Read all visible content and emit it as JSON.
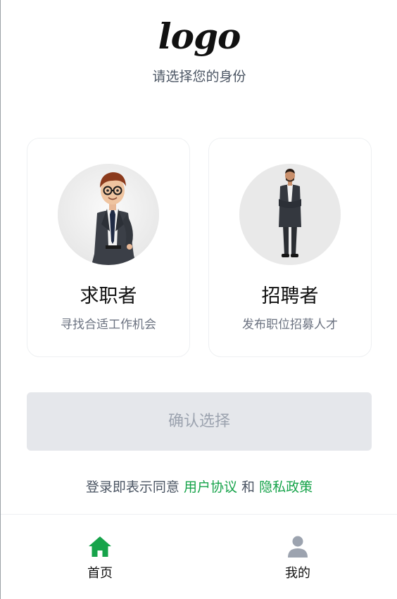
{
  "header": {
    "logo_text": "logo",
    "subtitle": "请选择您的身份"
  },
  "roles": [
    {
      "title": "求职者",
      "description": "寻找合适工作机会",
      "avatar": "cartoon-businessman-avatar"
    },
    {
      "title": "招聘者",
      "description": "发布职位招募人才",
      "avatar": "businessman-photo-avatar"
    }
  ],
  "confirm": {
    "label": "确认选择"
  },
  "agreement": {
    "prefix": "登录即表示同意",
    "user_agreement": "用户协议",
    "conjunction": "和",
    "privacy_policy": "隐私政策"
  },
  "tabbar": {
    "items": [
      {
        "label": "首页",
        "icon": "home-icon",
        "active": true
      },
      {
        "label": "我的",
        "icon": "user-icon",
        "active": false
      }
    ]
  },
  "colors": {
    "accent": "#16a34a",
    "button_disabled_bg": "#e5e7eb",
    "button_disabled_text": "#9ca3af",
    "icon_inactive": "#9ca3af"
  }
}
